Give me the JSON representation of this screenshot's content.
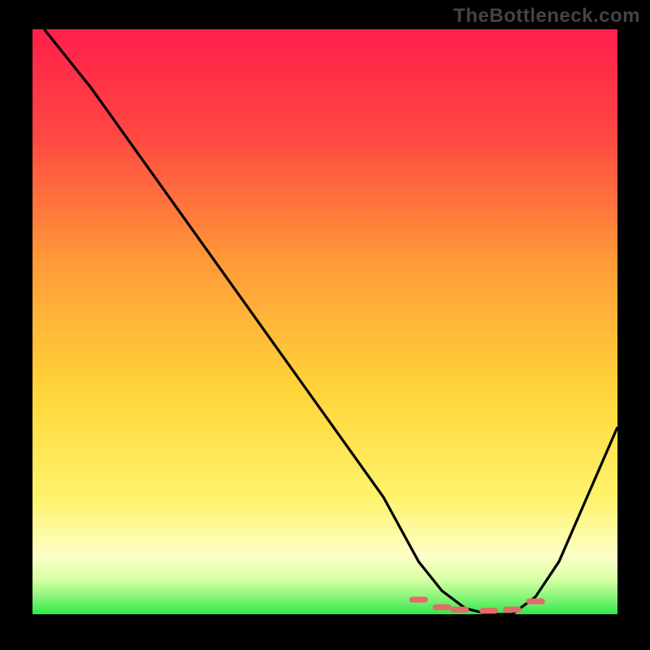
{
  "watermark": "TheBottleneck.com",
  "colors": {
    "bg": "#000000",
    "top": "#ff1f4c",
    "mid1": "#ff6a3a",
    "mid2": "#ffc93a",
    "mid3": "#fff36b",
    "pale": "#fdffc8",
    "green_light": "#b8ff8a",
    "green": "#2eea4a",
    "curve": "#000000",
    "marker": "#e46a6a"
  },
  "chart_data": {
    "type": "line",
    "title": "",
    "xlabel": "",
    "ylabel": "",
    "xlim": [
      0,
      100
    ],
    "ylim": [
      0,
      100
    ],
    "series": [
      {
        "name": "curve",
        "x": [
          2,
          10,
          20,
          30,
          40,
          50,
          60,
          66,
          70,
          74,
          78,
          82,
          86,
          90,
          100
        ],
        "y": [
          100,
          90,
          76,
          62,
          48,
          34,
          20,
          9,
          4,
          1,
          0,
          0,
          3,
          9,
          32
        ]
      },
      {
        "name": "markers",
        "x": [
          66,
          70,
          73,
          78,
          82,
          86
        ],
        "y": [
          2.5,
          1.2,
          0.8,
          0.6,
          0.8,
          2.2
        ]
      }
    ],
    "gradient_stops": [
      {
        "pos": 0.0,
        "color": "#ff1f4c"
      },
      {
        "pos": 0.18,
        "color": "#ff4742"
      },
      {
        "pos": 0.4,
        "color": "#ff9b38"
      },
      {
        "pos": 0.62,
        "color": "#ffd53a"
      },
      {
        "pos": 0.8,
        "color": "#fff36b"
      },
      {
        "pos": 0.9,
        "color": "#fdffc8"
      },
      {
        "pos": 0.94,
        "color": "#d8ffa6"
      },
      {
        "pos": 0.97,
        "color": "#8cf57a"
      },
      {
        "pos": 1.0,
        "color": "#2eea4a"
      }
    ]
  }
}
